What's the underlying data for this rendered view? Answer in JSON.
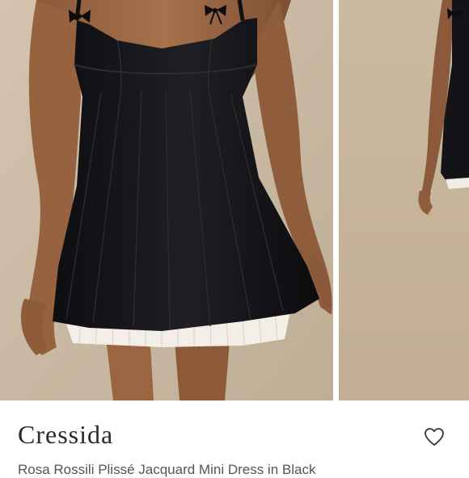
{
  "product": {
    "title": "Cressida",
    "subtitle": "Rosa Rossili Plissé Jacquard Mini Dress in Black"
  },
  "gallery": {
    "images": [
      {
        "alt": "Model wearing black mini dress with bow straps and white pleated underskirt"
      },
      {
        "alt": "Second view of model wearing the black mini dress"
      }
    ]
  },
  "icons": {
    "favorite": "heart-outline-icon"
  },
  "colors": {
    "background": "#ffffff",
    "title_text": "#2a2a2a",
    "photo_backdrop": "#cdbca6",
    "dress": "#16161a",
    "underskirt": "#f3efe8"
  }
}
